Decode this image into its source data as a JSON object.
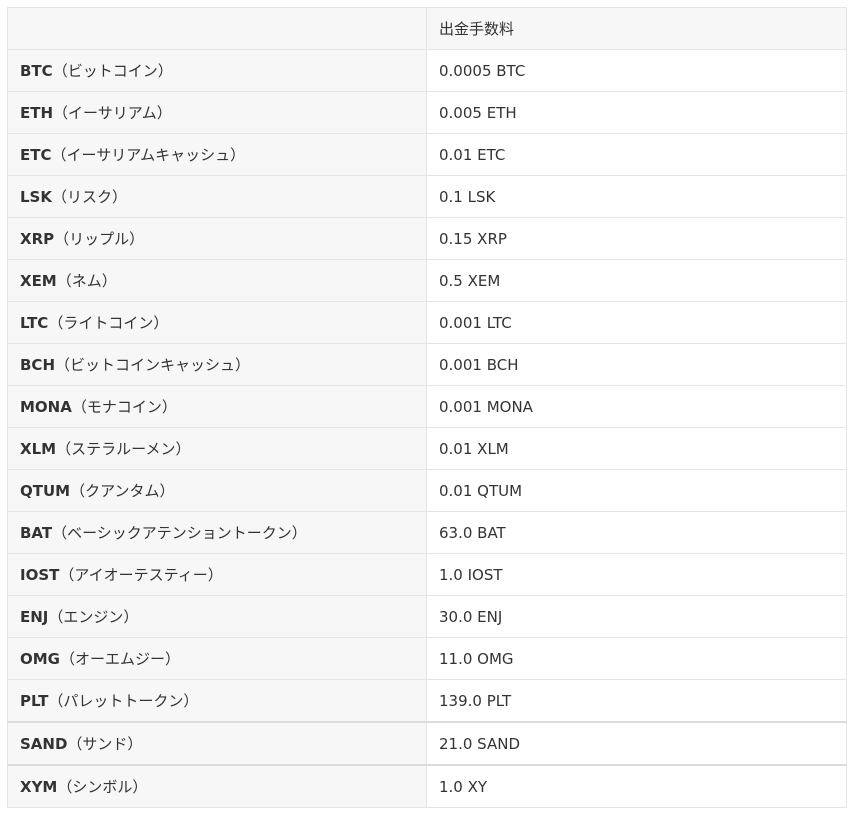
{
  "table": {
    "header": {
      "col1": "",
      "col2": "出金手数料"
    },
    "rows": [
      {
        "code": "BTC",
        "name": "（ビットコイン）",
        "fee": "0.0005 BTC"
      },
      {
        "code": "ETH",
        "name": "（イーサリアム）",
        "fee": "0.005 ETH"
      },
      {
        "code": "ETC",
        "name": "（イーサリアムキャッシュ）",
        "fee": "0.01 ETC"
      },
      {
        "code": "LSK",
        "name": "（リスク）",
        "fee": "0.1 LSK"
      },
      {
        "code": "XRP",
        "name": "（リップル）",
        "fee": "0.15 XRP"
      },
      {
        "code": "XEM",
        "name": "（ネム）",
        "fee": "0.5 XEM"
      },
      {
        "code": "LTC",
        "name": "（ライトコイン）",
        "fee": "0.001 LTC"
      },
      {
        "code": "BCH",
        "name": "（ビットコインキャッシュ）",
        "fee": "0.001 BCH"
      },
      {
        "code": "MONA",
        "name": "（モナコイン）",
        "fee": "0.001 MONA"
      },
      {
        "code": "XLM",
        "name": "（ステラルーメン）",
        "fee": "0.01 XLM"
      },
      {
        "code": "QTUM",
        "name": "（クアンタム）",
        "fee": "0.01 QTUM"
      },
      {
        "code": "BAT",
        "name": "（ベーシックアテンショントークン）",
        "fee": "63.0 BAT"
      },
      {
        "code": "IOST",
        "name": "（アイオーテスティー）",
        "fee": "1.0 IOST"
      },
      {
        "code": "ENJ",
        "name": "（エンジン）",
        "fee": "30.0 ENJ"
      },
      {
        "code": "OMG",
        "name": "（オーエムジー）",
        "fee": "11.0 OMG"
      },
      {
        "code": "PLT",
        "name": "（パレットトークン）",
        "fee": "139.0 PLT"
      },
      {
        "code": "SAND",
        "name": "（サンド）",
        "fee": "21.0 SAND"
      },
      {
        "code": "XYM",
        "name": "（シンボル）",
        "fee": "1.0 XY"
      }
    ]
  }
}
